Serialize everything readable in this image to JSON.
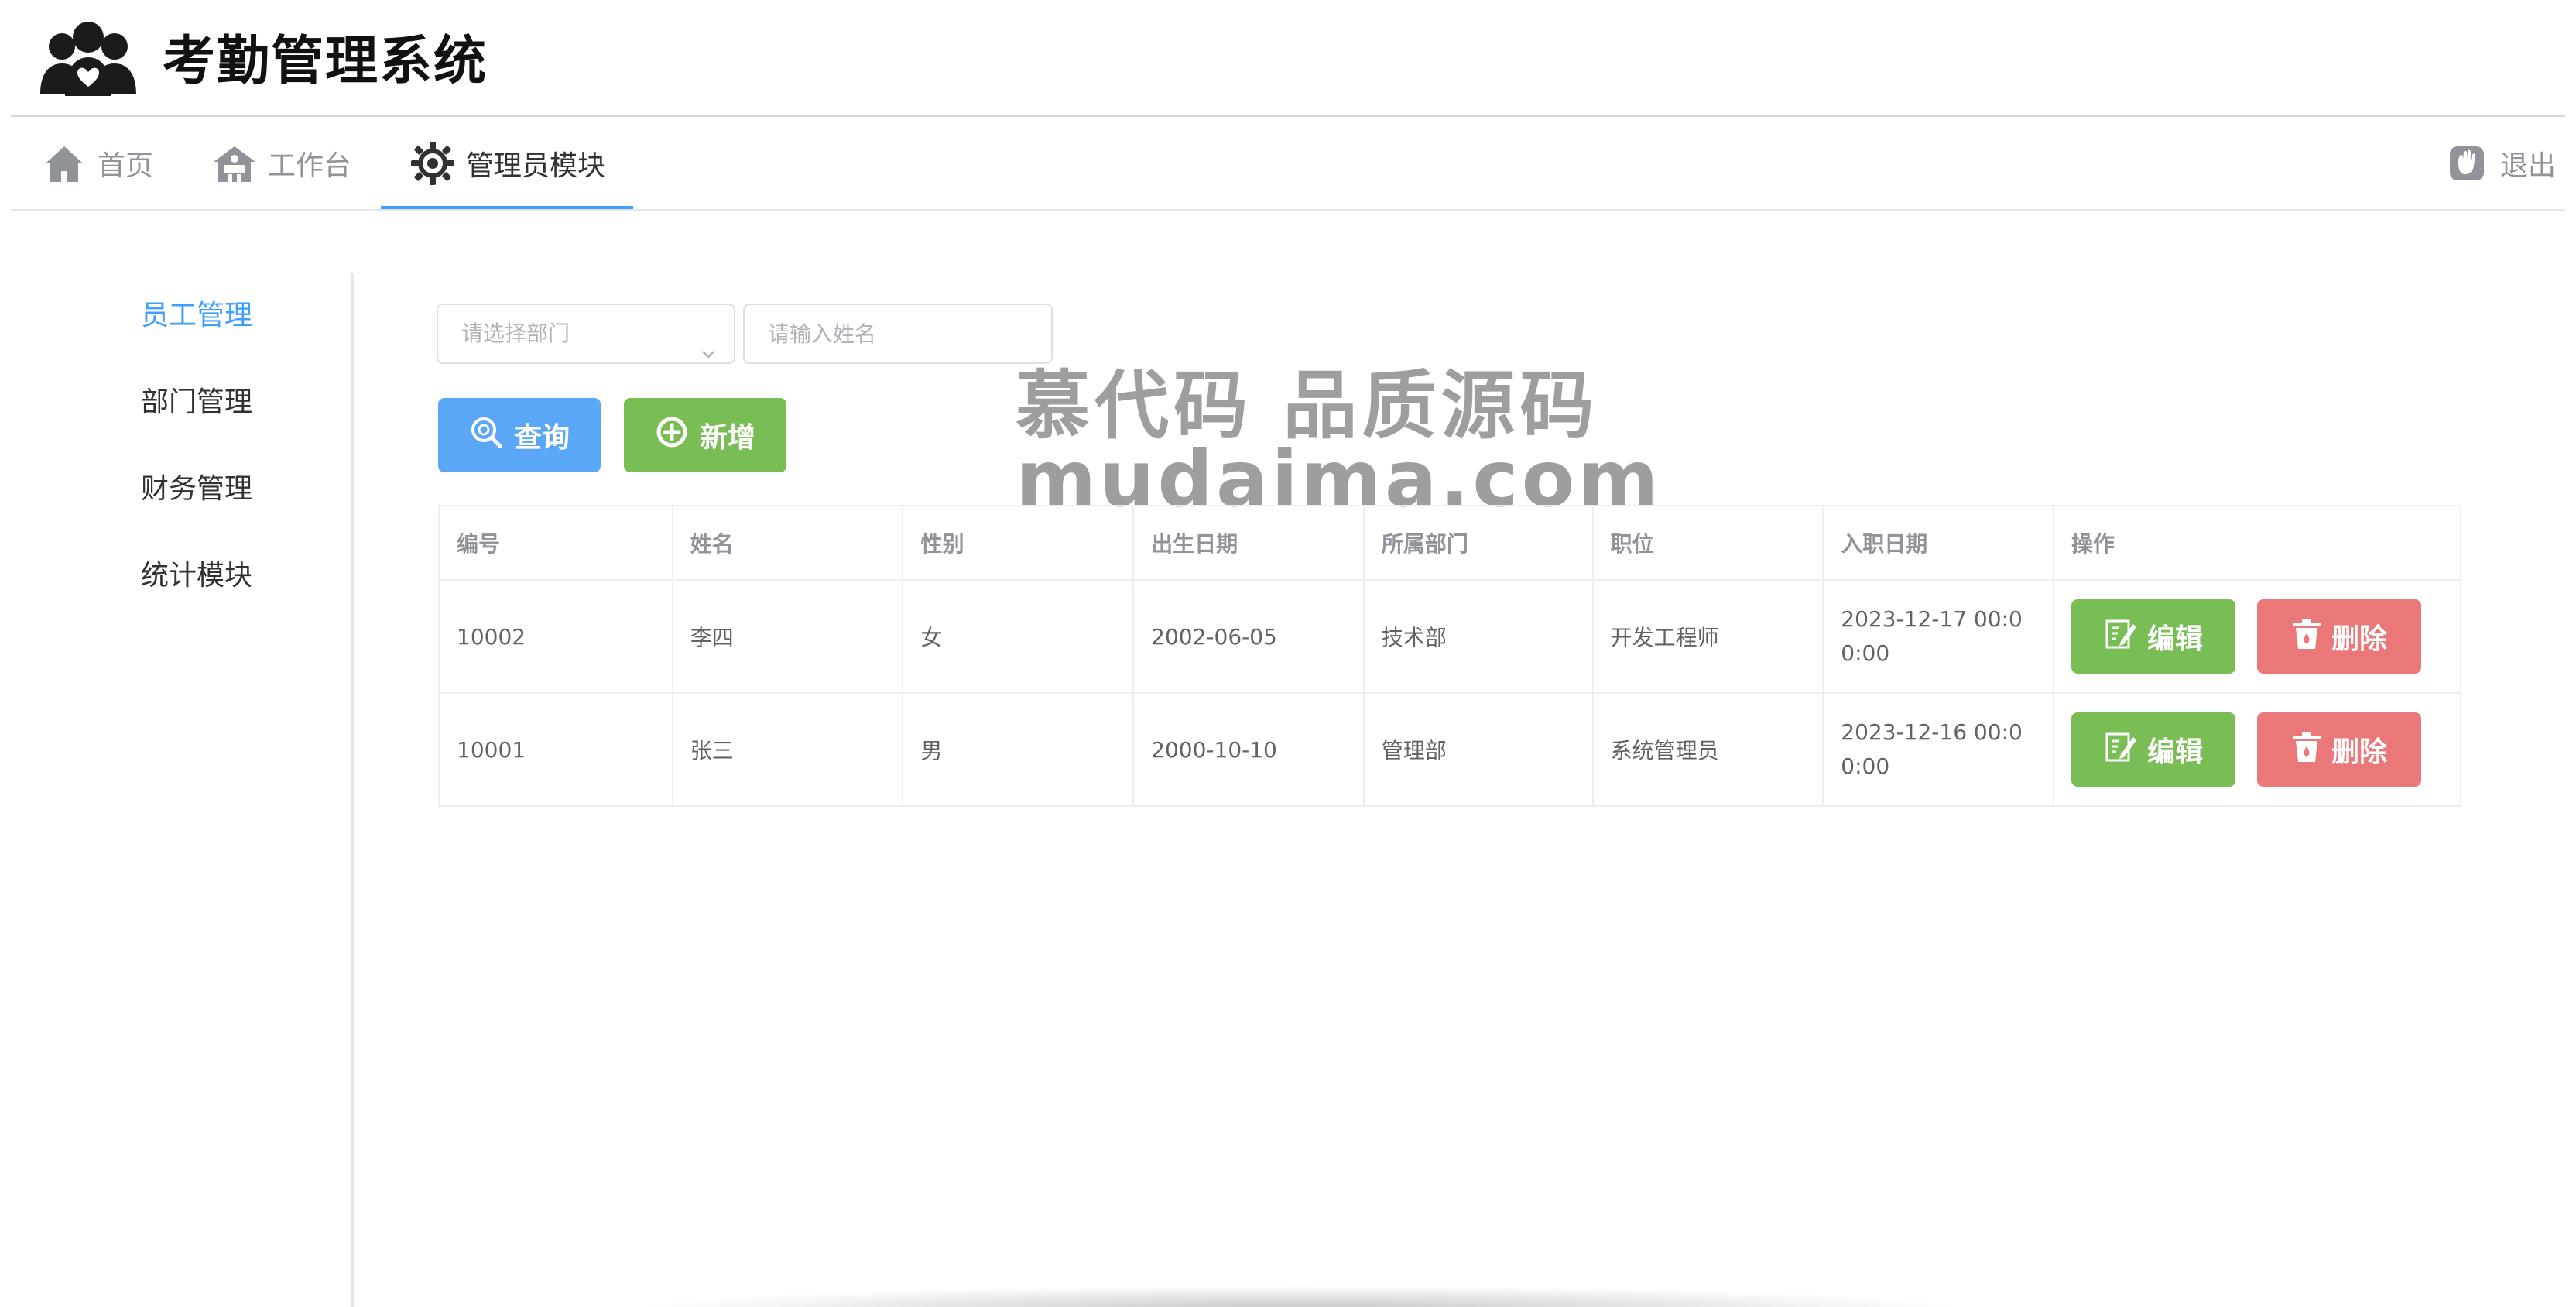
{
  "app": {
    "title": "考勤管理系统",
    "logo_icon": "people-group-icon"
  },
  "nav": {
    "items": [
      {
        "label": "首页",
        "icon": "home-icon"
      },
      {
        "label": "工作台",
        "icon": "workbench-icon"
      },
      {
        "label": "管理员模块",
        "icon": "admin-gear-icon"
      }
    ],
    "active": "管理员模块",
    "logout": {
      "label": "退出",
      "icon": "logout-icon"
    }
  },
  "sidebar": {
    "items": [
      {
        "label": "员工管理"
      },
      {
        "label": "部门管理"
      },
      {
        "label": "财务管理"
      },
      {
        "label": "统计模块"
      }
    ],
    "active": "员工管理"
  },
  "filters": {
    "department_placeholder": "请选择部门",
    "name_placeholder": "请输入姓名",
    "name_value": ""
  },
  "toolbar": {
    "query_label": "查询",
    "add_label": "新增"
  },
  "watermark": {
    "line1": "慕代码 品质源码",
    "line2": "mudaima.com"
  },
  "table": {
    "headers": [
      "编号",
      "姓名",
      "性别",
      "出生日期",
      "所属部门",
      "职位",
      "入职日期",
      "操作"
    ],
    "rows": [
      {
        "id": "10002",
        "name": "李四",
        "sex": "女",
        "birth": "2002-06-05",
        "dept": "技术部",
        "position": "开发工程师",
        "hire_date": "2023-12-17 00:00:00",
        "edit_label": "编辑",
        "delete_label": "删除"
      },
      {
        "id": "10001",
        "name": "张三",
        "sex": "男",
        "birth": "2000-10-10",
        "dept": "管理部",
        "position": "系统管理员",
        "hire_date": "2023-12-16 00:00:00",
        "edit_label": "编辑",
        "delete_label": "删除"
      }
    ]
  },
  "colors": {
    "primary": "#409eff",
    "query_button": "#5aa7f7",
    "success_button": "#79bd55",
    "danger_button": "#ea7878"
  }
}
